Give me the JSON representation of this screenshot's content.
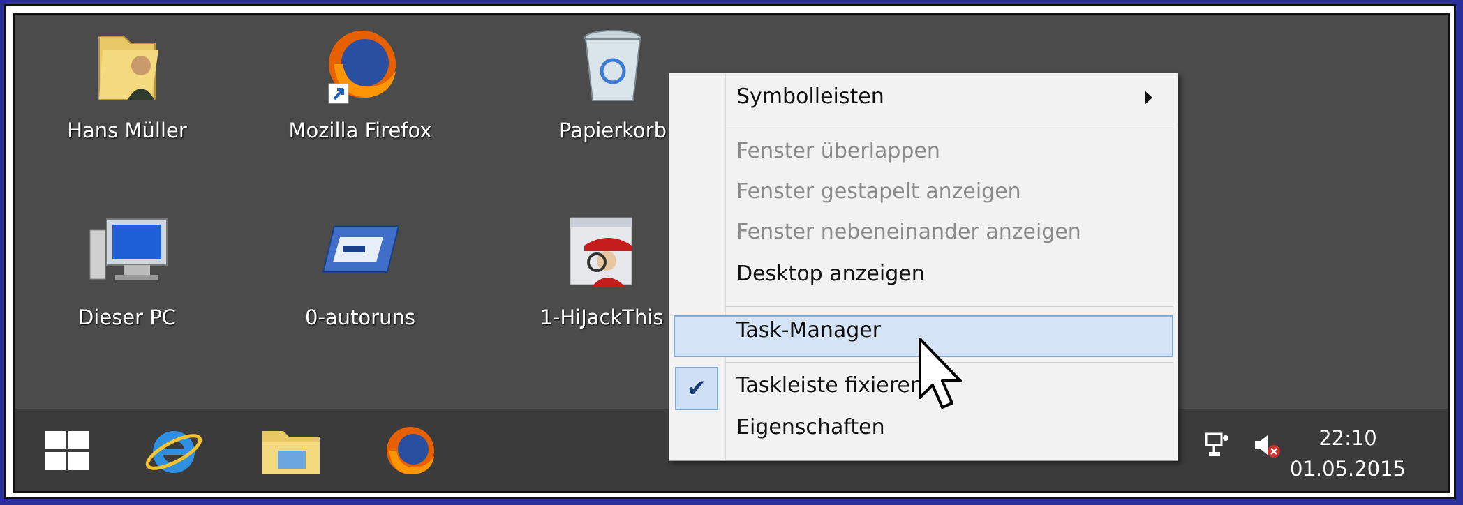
{
  "desktop": {
    "icons": [
      {
        "label": "Hans Müller"
      },
      {
        "label": "Mozilla Firefox"
      },
      {
        "label": "Papierkorb"
      },
      {
        "label": "Dieser PC"
      },
      {
        "label": "0-autoruns"
      },
      {
        "label": "1-HiJackThis"
      }
    ]
  },
  "context_menu": {
    "items": [
      {
        "label": "Symbolleisten",
        "submenu": true
      },
      {
        "label": "Fenster überlappen",
        "enabled": false
      },
      {
        "label": "Fenster gestapelt anzeigen",
        "enabled": false
      },
      {
        "label": "Fenster nebeneinander anzeigen",
        "enabled": false
      },
      {
        "label": "Desktop anzeigen",
        "enabled": true
      },
      {
        "label": "Task-Manager",
        "highlighted": true
      },
      {
        "label": "Taskleiste fixieren",
        "checked": true
      },
      {
        "label": "Eigenschaften",
        "enabled": true
      }
    ],
    "check_glyph": "✔"
  },
  "taskbar": {
    "time": "22:10",
    "date": "01.05.2015",
    "tray_arrow": "▲"
  },
  "colors": {
    "desktop_bg": "#4b4b4b",
    "taskbar_bg": "#3b3b3b",
    "menu_highlight": "#d4e3f5",
    "frame_outer": "#2a2f9a"
  }
}
